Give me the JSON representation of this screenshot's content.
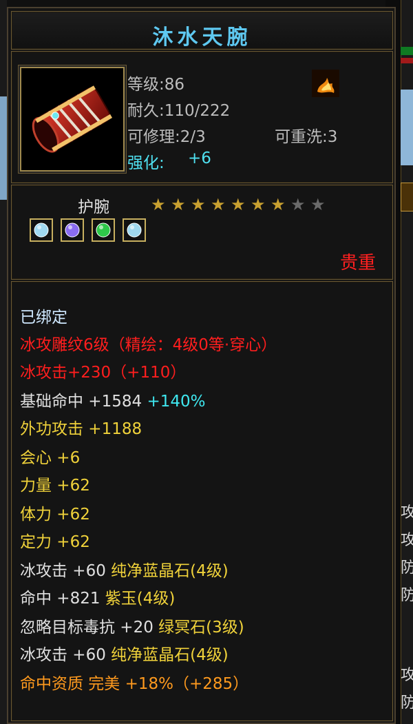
{
  "item": {
    "name": "沐水天腕",
    "level_text": "等级:86",
    "durability_text": "耐久:110/222",
    "repairable_text": "可修理:2/3",
    "rewash_text": "可重洗:3",
    "enhance_label": "强化:",
    "enhance_value": "+6",
    "type": "护腕",
    "stars_filled": 7,
    "stars_total": 9,
    "rarity": "贵重",
    "icon": "red-bracer-icon",
    "element_icon": "fire-element-icon"
  },
  "gems": [
    {
      "name": "ice-gem-icon",
      "color": "#9fd8f0"
    },
    {
      "name": "purple-gem-icon",
      "color": "#8a6cf0"
    },
    {
      "name": "green-gem-icon",
      "color": "#2ec84a"
    },
    {
      "name": "ice-gem-icon",
      "color": "#9fd8f0"
    }
  ],
  "stats": {
    "bound": "已绑定",
    "carve": "冰攻雕纹6级（精绘：4级0等·穿心）",
    "ice_attack_main": "冰攻击+230（+110）",
    "hit_label": "基础命中  +1584",
    "hit_bonus": "+140%",
    "ext_attack": "外功攻击  +1188",
    "crit": "会心  +6",
    "strength": "力量  +62",
    "stamina": "体力  +62",
    "focus": "定力  +62",
    "gem1_stat": "冰攻击  +60",
    "gem1_name": "纯净蓝晶石(4级)",
    "gem2_stat": "命中  +821",
    "gem2_name": "紫玉(4级)",
    "gem3_stat": "忽略目标毒抗  +20",
    "gem3_name": "绿冥石(3级)",
    "gem4_stat": "冰攻击  +60",
    "gem4_name": "纯净蓝晶石(4级)",
    "aptitude": "命中资质   完美  +18%（+285）"
  },
  "background_text": [
    "攻",
    "攻",
    "防",
    "防",
    "攻",
    "防"
  ],
  "colors": {
    "title": "#5ec8f0",
    "rarity": "#ff2020",
    "frame": "#6b5a35"
  }
}
